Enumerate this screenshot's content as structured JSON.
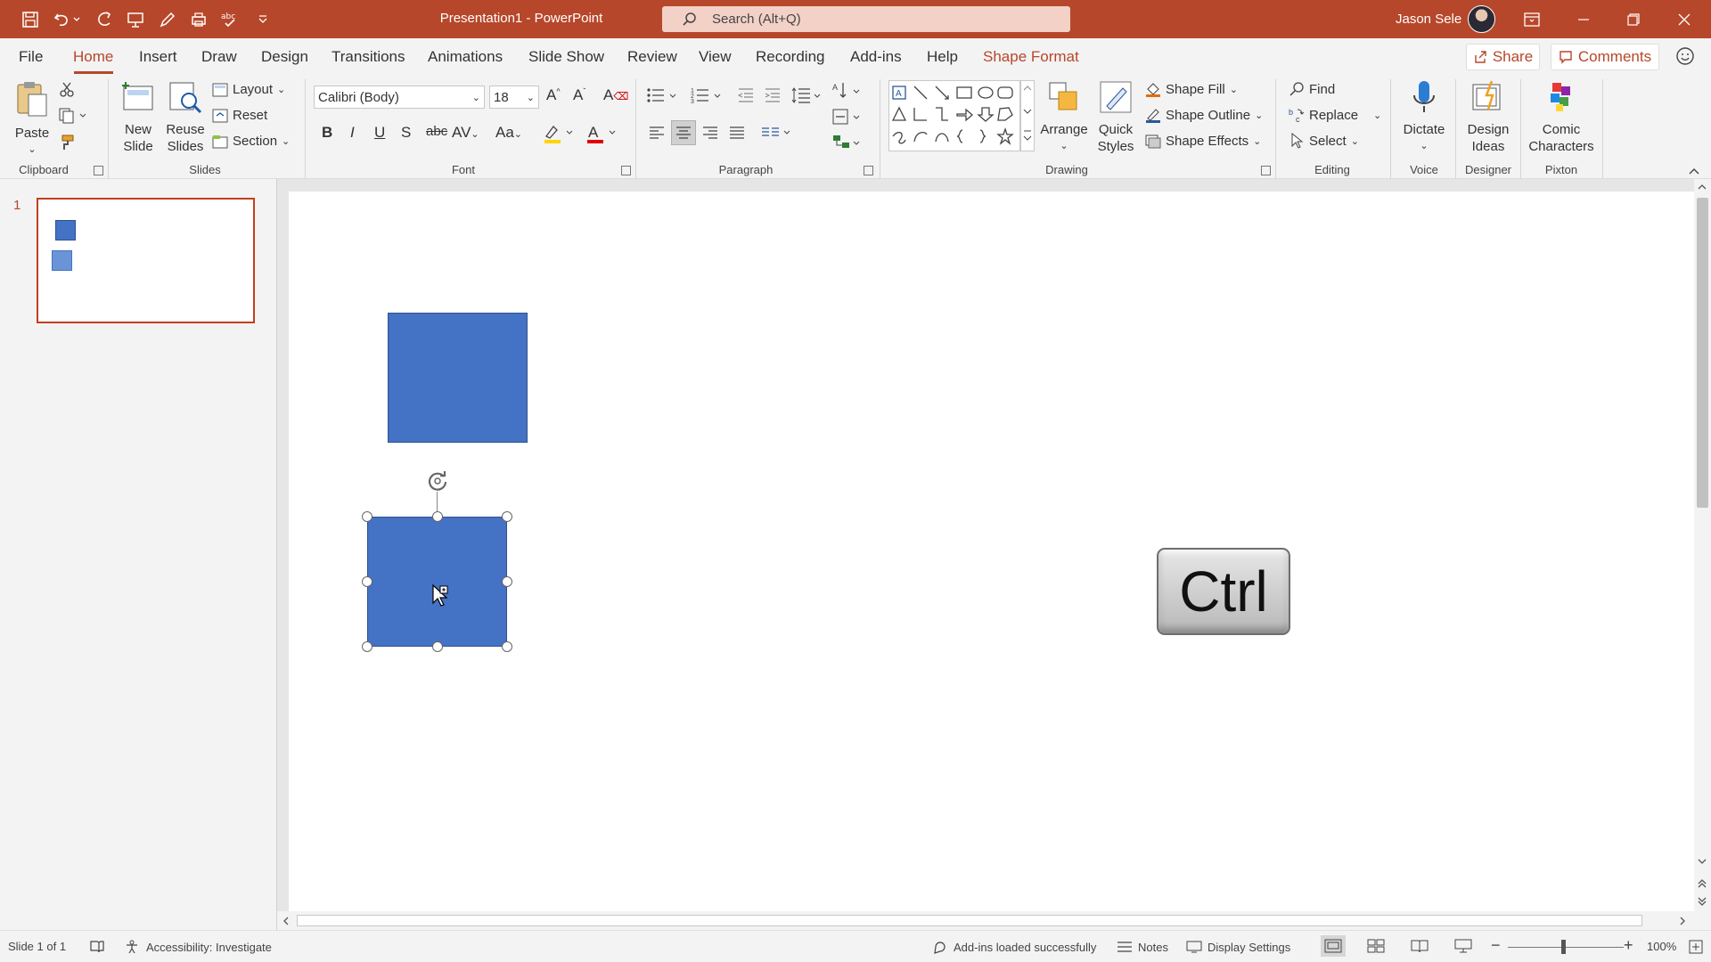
{
  "titlebar": {
    "doc_title": "Presentation1  -  PowerPoint",
    "search_placeholder": "Search (Alt+Q)",
    "user_name": "Jason Sele",
    "accent_color": "#b7472a"
  },
  "tabs": {
    "items": [
      "File",
      "Home",
      "Insert",
      "Draw",
      "Design",
      "Transitions",
      "Animations",
      "Slide Show",
      "Review",
      "View",
      "Recording",
      "Add-ins",
      "Help",
      "Shape Format"
    ],
    "active": "Home",
    "share": "Share",
    "comments": "Comments"
  },
  "ribbon": {
    "clipboard": {
      "paste": "Paste",
      "label": "Clipboard"
    },
    "slides": {
      "new_slide": "New Slide",
      "reuse_slides": "Reuse Slides",
      "layout": "Layout",
      "reset": "Reset",
      "section": "Section",
      "label": "Slides"
    },
    "font": {
      "font_name": "Calibri (Body)",
      "font_size": "18",
      "label": "Font"
    },
    "paragraph": {
      "label": "Paragraph"
    },
    "drawing": {
      "arrange": "Arrange",
      "quick_styles": "Quick Styles",
      "shape_fill": "Shape Fill",
      "shape_outline": "Shape Outline",
      "shape_effects": "Shape Effects",
      "label": "Drawing"
    },
    "editing": {
      "find": "Find",
      "replace": "Replace",
      "select": "Select",
      "label": "Editing"
    },
    "voice": {
      "dictate": "Dictate",
      "label": "Voice"
    },
    "designer": {
      "design_ideas": "Design Ideas",
      "label": "Designer"
    },
    "pixton": {
      "comic_characters": "Comic Characters",
      "label": "Pixton"
    }
  },
  "slides_pane": {
    "slide_number": "1"
  },
  "canvas": {
    "shape_fill_color": "#4472c4",
    "ctrl_key_label": "Ctrl"
  },
  "statusbar": {
    "slide_info": "Slide 1 of 1",
    "accessibility": "Accessibility: Investigate",
    "addins": "Add-ins loaded successfully",
    "notes": "Notes",
    "display_settings": "Display Settings",
    "zoom": "100%"
  }
}
